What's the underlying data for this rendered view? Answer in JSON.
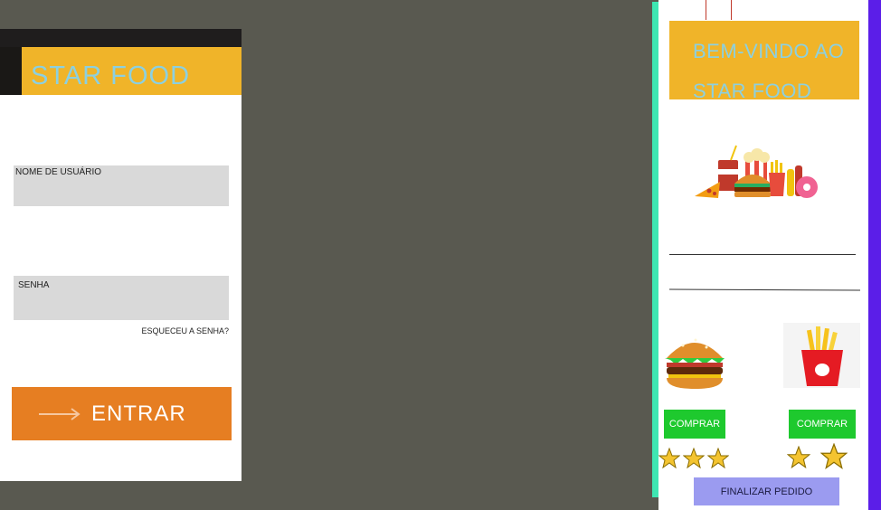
{
  "login": {
    "brand": "STAR FOOD",
    "username_label": "NOME DE USUÁRIO",
    "username_value": "",
    "password_label": "SENHA",
    "password_value": "",
    "forgot_link": "ESQUECEU A SENHA?",
    "enter_button": "ENTRAR",
    "colors": {
      "brand_bg": "#f0b429",
      "brand_text": "#8cd0e0",
      "button_bg": "#e67e22"
    }
  },
  "store": {
    "welcome": "BEM-VINDO AO STAR FOOD",
    "hero_icon": "fast-food-illustration",
    "products": [
      {
        "icon": "burger-icon",
        "buy_label": "COMPRAR",
        "rating": 3
      },
      {
        "icon": "fries-icon",
        "buy_label": "COMPRAR",
        "rating": 2
      }
    ],
    "finalize_button": "FINALIZAR PEDIDO",
    "colors": {
      "buy_bg": "#1ec92e",
      "finalize_bg": "#9b9bf0",
      "accent_left": "#3ee6b2",
      "accent_right": "#5b1ee8"
    }
  }
}
